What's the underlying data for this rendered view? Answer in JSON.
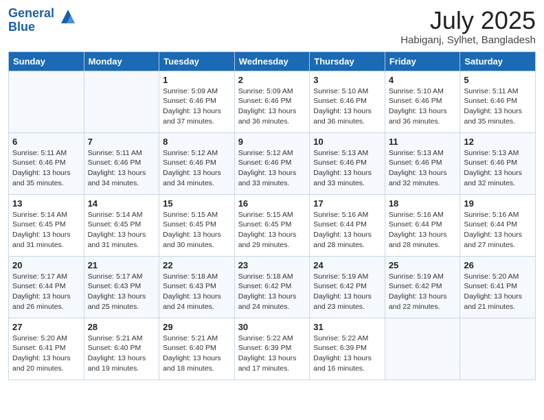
{
  "header": {
    "logo_line1": "General",
    "logo_line2": "Blue",
    "month": "July 2025",
    "location": "Habiganj, Sylhet, Bangladesh"
  },
  "weekdays": [
    "Sunday",
    "Monday",
    "Tuesday",
    "Wednesday",
    "Thursday",
    "Friday",
    "Saturday"
  ],
  "weeks": [
    [
      {
        "day": "",
        "info": ""
      },
      {
        "day": "",
        "info": ""
      },
      {
        "day": "1",
        "info": "Sunrise: 5:09 AM\nSunset: 6:46 PM\nDaylight: 13 hours and 37 minutes."
      },
      {
        "day": "2",
        "info": "Sunrise: 5:09 AM\nSunset: 6:46 PM\nDaylight: 13 hours and 36 minutes."
      },
      {
        "day": "3",
        "info": "Sunrise: 5:10 AM\nSunset: 6:46 PM\nDaylight: 13 hours and 36 minutes."
      },
      {
        "day": "4",
        "info": "Sunrise: 5:10 AM\nSunset: 6:46 PM\nDaylight: 13 hours and 36 minutes."
      },
      {
        "day": "5",
        "info": "Sunrise: 5:11 AM\nSunset: 6:46 PM\nDaylight: 13 hours and 35 minutes."
      }
    ],
    [
      {
        "day": "6",
        "info": "Sunrise: 5:11 AM\nSunset: 6:46 PM\nDaylight: 13 hours and 35 minutes."
      },
      {
        "day": "7",
        "info": "Sunrise: 5:11 AM\nSunset: 6:46 PM\nDaylight: 13 hours and 34 minutes."
      },
      {
        "day": "8",
        "info": "Sunrise: 5:12 AM\nSunset: 6:46 PM\nDaylight: 13 hours and 34 minutes."
      },
      {
        "day": "9",
        "info": "Sunrise: 5:12 AM\nSunset: 6:46 PM\nDaylight: 13 hours and 33 minutes."
      },
      {
        "day": "10",
        "info": "Sunrise: 5:13 AM\nSunset: 6:46 PM\nDaylight: 13 hours and 33 minutes."
      },
      {
        "day": "11",
        "info": "Sunrise: 5:13 AM\nSunset: 6:46 PM\nDaylight: 13 hours and 32 minutes."
      },
      {
        "day": "12",
        "info": "Sunrise: 5:13 AM\nSunset: 6:46 PM\nDaylight: 13 hours and 32 minutes."
      }
    ],
    [
      {
        "day": "13",
        "info": "Sunrise: 5:14 AM\nSunset: 6:45 PM\nDaylight: 13 hours and 31 minutes."
      },
      {
        "day": "14",
        "info": "Sunrise: 5:14 AM\nSunset: 6:45 PM\nDaylight: 13 hours and 31 minutes."
      },
      {
        "day": "15",
        "info": "Sunrise: 5:15 AM\nSunset: 6:45 PM\nDaylight: 13 hours and 30 minutes."
      },
      {
        "day": "16",
        "info": "Sunrise: 5:15 AM\nSunset: 6:45 PM\nDaylight: 13 hours and 29 minutes."
      },
      {
        "day": "17",
        "info": "Sunrise: 5:16 AM\nSunset: 6:44 PM\nDaylight: 13 hours and 28 minutes."
      },
      {
        "day": "18",
        "info": "Sunrise: 5:16 AM\nSunset: 6:44 PM\nDaylight: 13 hours and 28 minutes."
      },
      {
        "day": "19",
        "info": "Sunrise: 5:16 AM\nSunset: 6:44 PM\nDaylight: 13 hours and 27 minutes."
      }
    ],
    [
      {
        "day": "20",
        "info": "Sunrise: 5:17 AM\nSunset: 6:44 PM\nDaylight: 13 hours and 26 minutes."
      },
      {
        "day": "21",
        "info": "Sunrise: 5:17 AM\nSunset: 6:43 PM\nDaylight: 13 hours and 25 minutes."
      },
      {
        "day": "22",
        "info": "Sunrise: 5:18 AM\nSunset: 6:43 PM\nDaylight: 13 hours and 24 minutes."
      },
      {
        "day": "23",
        "info": "Sunrise: 5:18 AM\nSunset: 6:42 PM\nDaylight: 13 hours and 24 minutes."
      },
      {
        "day": "24",
        "info": "Sunrise: 5:19 AM\nSunset: 6:42 PM\nDaylight: 13 hours and 23 minutes."
      },
      {
        "day": "25",
        "info": "Sunrise: 5:19 AM\nSunset: 6:42 PM\nDaylight: 13 hours and 22 minutes."
      },
      {
        "day": "26",
        "info": "Sunrise: 5:20 AM\nSunset: 6:41 PM\nDaylight: 13 hours and 21 minutes."
      }
    ],
    [
      {
        "day": "27",
        "info": "Sunrise: 5:20 AM\nSunset: 6:41 PM\nDaylight: 13 hours and 20 minutes."
      },
      {
        "day": "28",
        "info": "Sunrise: 5:21 AM\nSunset: 6:40 PM\nDaylight: 13 hours and 19 minutes."
      },
      {
        "day": "29",
        "info": "Sunrise: 5:21 AM\nSunset: 6:40 PM\nDaylight: 13 hours and 18 minutes."
      },
      {
        "day": "30",
        "info": "Sunrise: 5:22 AM\nSunset: 6:39 PM\nDaylight: 13 hours and 17 minutes."
      },
      {
        "day": "31",
        "info": "Sunrise: 5:22 AM\nSunset: 6:39 PM\nDaylight: 13 hours and 16 minutes."
      },
      {
        "day": "",
        "info": ""
      },
      {
        "day": "",
        "info": ""
      }
    ]
  ]
}
